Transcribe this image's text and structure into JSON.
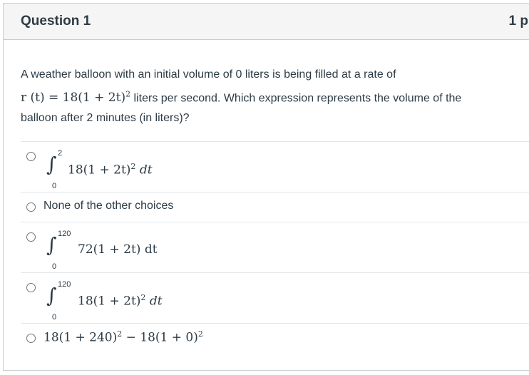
{
  "question": {
    "title": "Question 1",
    "points": "1 p",
    "stem_part1": "A weather balloon with an initial volume of 0 liters is being filled at a rate of",
    "rate_lhs": "r (t) = 18(1 + 2t)",
    "rate_exp": "2",
    "stem_part2": " liters per second. Which expression represents the volume of the",
    "stem_part3": "balloon after 2 minutes (in liters)?"
  },
  "answers": [
    {
      "upper": "2",
      "lower": "0",
      "integrand": "18(1 + 2t)",
      "exp": "2",
      "suffix": " dt"
    },
    {
      "text": "None of the other choices"
    },
    {
      "upper": "120",
      "lower": "0",
      "integrand": "72(1 + 2t) dt"
    },
    {
      "upper": "120",
      "lower": "0",
      "integrand": "18(1 + 2t)",
      "exp": "2",
      "suffix": " dt"
    },
    {
      "part1": "18(1 + 240)",
      "exp1": "2",
      "part2": " − 18(1 + 0)",
      "exp2": "2"
    }
  ]
}
